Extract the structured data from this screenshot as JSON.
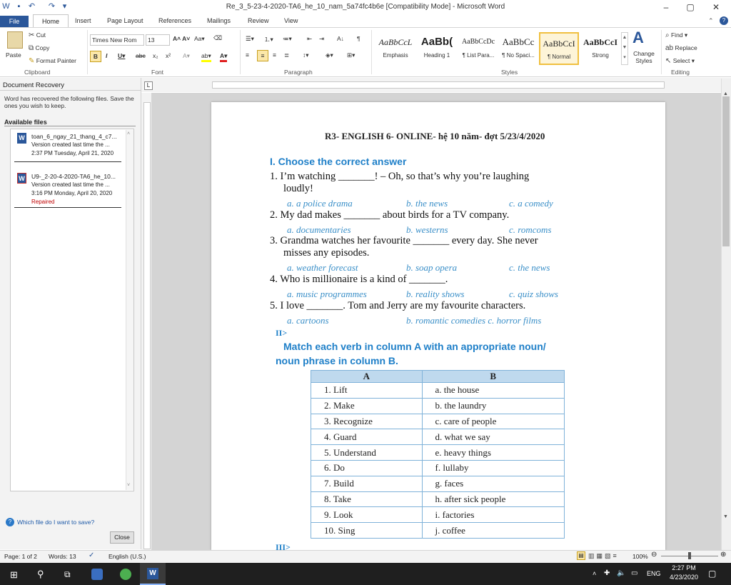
{
  "window": {
    "title": "Re_3_5-23-4-2020-TA6_he_10_nam_5a74fc4b6e [Compatibility Mode]  -  Microsoft Word",
    "min": "–",
    "max": "▢",
    "close": "✕"
  },
  "tabs": {
    "file": "File",
    "items": [
      "Home",
      "Insert",
      "Page Layout",
      "References",
      "Mailings",
      "Review",
      "View"
    ]
  },
  "ribbon": {
    "clipboard": {
      "paste": "Paste",
      "cut": "Cut",
      "copy": "Copy",
      "format_painter": "Format Painter",
      "label": "Clipboard"
    },
    "font": {
      "name": "Times New Rom",
      "size": "13",
      "label": "Font"
    },
    "paragraph": {
      "label": "Paragraph"
    },
    "styles": {
      "items": [
        {
          "sample": "AaBbCcL",
          "name": "Emphasis"
        },
        {
          "sample": "AaBb(",
          "name": "Heading 1"
        },
        {
          "sample": "AaBbCcDc",
          "name": "¶ List Para..."
        },
        {
          "sample": "AaBbCc",
          "name": "¶ No Spaci..."
        },
        {
          "sample": "AaBbCcI",
          "name": "¶ Normal"
        },
        {
          "sample": "AaBbCcI",
          "name": "Strong"
        }
      ],
      "change_styles": "Change Styles",
      "label": "Styles"
    },
    "editing": {
      "find": "Find",
      "replace": "Replace",
      "select": "Select",
      "label": "Editing"
    }
  },
  "recovery": {
    "title": "Document Recovery",
    "desc": "Word has recovered the following files.  Save the ones you wish to keep.",
    "available": "Available files",
    "files": [
      {
        "name": "toan_6_ngay_21_thang_4_c7...",
        "line2": "Version created last time the ...",
        "line3": "2:37 PM Tuesday, April 21, 2020",
        "status": ""
      },
      {
        "name": "U9-_2-20-4-2020-TA6_he_10...",
        "line2": "Version created last time the ...",
        "line3": "3:16 PM Monday, April 20, 2020",
        "status": "Repaired"
      }
    ],
    "help": "Which file do I want to save?",
    "close": "Close"
  },
  "doc": {
    "header": "R3- ENGLISH  6- ONLINE- hệ 10 năm- đợt  5/23/4/2020",
    "section1": "I. Choose the correct answer",
    "q1a": "1. I’m watching _______! – Oh, so that’s why you’re laughing",
    "q1b": "loudly!",
    "q1_opts": [
      "a. a police drama",
      "b. the news",
      "c. a comedy"
    ],
    "q2": "2.  My dad makes _______ about birds for a TV company.",
    "q2_opts": [
      "a. documentaries",
      "b. westerns",
      "c. romcoms"
    ],
    "q3a": "3. Grandma watches her favourite _______ every day. She never",
    "q3b": "misses any episodes.",
    "q3_opts": [
      "a.   weather forecast",
      "b. soap opera",
      "c. the news"
    ],
    "q4": "4.  Who is millionaire is a kind of _______.",
    "q4_opts": [
      "a.   music programmes",
      "b. reality shows",
      "c. quiz shows"
    ],
    "q5": "5.  I love _______. Tom and Jerry are my favourite characters.",
    "q5_opts": [
      "a.   cartoons",
      "b. romantic comedies c. horror films"
    ],
    "section2_num": "II>",
    "section2a": "Match each verb in column A with an appropriate noun/",
    "section2b": "noun phrase in column B.",
    "table_head": [
      "A",
      "B"
    ],
    "table_rows": [
      [
        "1. Lift",
        "a. the house"
      ],
      [
        "2. Make",
        "b. the laundry"
      ],
      [
        "3. Recognize",
        "c. care of people"
      ],
      [
        "4. Guard",
        "d. what we say"
      ],
      [
        "5. Understand",
        "e. heavy things"
      ],
      [
        "6. Do",
        "f. lullaby"
      ],
      [
        "7. Build",
        "g. faces"
      ],
      [
        "8. Take",
        "h. after sick people"
      ],
      [
        "9. Look",
        "i. factories"
      ],
      [
        "10. Sing",
        "j. coffee"
      ]
    ],
    "section3_num": "III>"
  },
  "status": {
    "page": "Page: 1 of 2",
    "words": "Words: 13",
    "lang": "English (U.S.)",
    "zoom": "100%"
  },
  "taskbar": {
    "lang": "ENG",
    "time": "2:27 PM",
    "date": "4/23/2020"
  }
}
